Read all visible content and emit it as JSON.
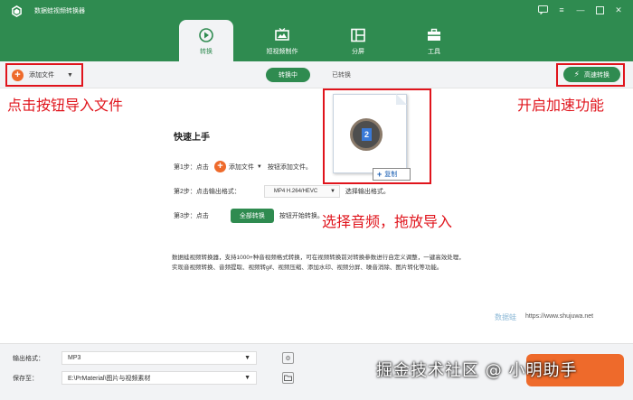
{
  "app": {
    "title": "数据蛙视频转换器"
  },
  "tabs": [
    {
      "label": "转换",
      "icon": "convert-icon"
    },
    {
      "label": "短视频制作",
      "icon": "tv-icon"
    },
    {
      "label": "分屏",
      "icon": "split-screen-icon"
    },
    {
      "label": "工具",
      "icon": "toolbox-icon"
    }
  ],
  "toolbar": {
    "add_files": "添加文件",
    "converting": "转换中",
    "converted": "已转换",
    "speed": "高速转换"
  },
  "annotations": {
    "add_hint": "点击按钮导入文件",
    "speed_hint": "开启加速功能",
    "drag_hint": "选择音频，拖放导入"
  },
  "drag": {
    "badge_number": "2",
    "copy_label": "复制"
  },
  "guide": {
    "title": "快速上手",
    "step1_label": "第1步：点击",
    "step1_btn": "添加文件",
    "step1_tail": "按钮添加文件。",
    "step2_label": "第2步：点击输出格式：",
    "step2_value": "MP4 H.264/HEVC",
    "step2_tail": "选择输出格式。",
    "step3_label": "第3步：点击",
    "step3_btn": "全部转换",
    "step3_tail": "按钮开始转换。",
    "desc": "数据蛙视频转换器，支持1000+种音视频格式转换，可在视频转换前对转换参数进行自定义调整，一键高效处理，实现音视频转换、音频提取、视频转gif、视频压缩、添加水印、视频分屏、噪音消除、图片转化等功能。"
  },
  "watermark": {
    "brand": "数据蛙",
    "url": "https://www.shujuwa.net"
  },
  "bottom": {
    "output_label": "输出格式：",
    "output_value": "MP3",
    "save_label": "保存至：",
    "save_value": "E:\\PrMaterial\\图片与视频素材",
    "overlay_text": "掘金技术社区 @ 小明助手"
  },
  "colors": {
    "brand_green": "#2f8b50",
    "accent_orange": "#ee6a2b",
    "annotation_red": "#e0141c"
  }
}
